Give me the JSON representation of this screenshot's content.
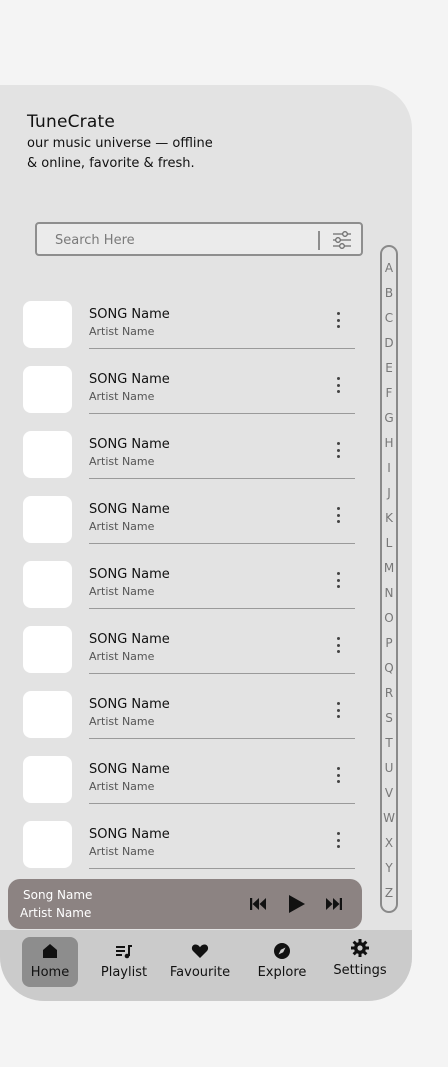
{
  "app": {
    "title": "TuneCrate",
    "tagline": "our music universe — offline & online, favorite & fresh."
  },
  "search": {
    "placeholder": "Search Here",
    "filter_icon": "filter-sliders-icon"
  },
  "songs": [
    {
      "name": "SONG Name",
      "artist": "Artist Name"
    },
    {
      "name": "SONG Name",
      "artist": "Artist Name"
    },
    {
      "name": "SONG Name",
      "artist": "Artist Name"
    },
    {
      "name": "SONG Name",
      "artist": "Artist Name"
    },
    {
      "name": "SONG Name",
      "artist": "Artist Name"
    },
    {
      "name": "SONG Name",
      "artist": "Artist Name"
    },
    {
      "name": "SONG Name",
      "artist": "Artist Name"
    },
    {
      "name": "SONG Name",
      "artist": "Artist Name"
    },
    {
      "name": "SONG Name",
      "artist": "Artist Name"
    }
  ],
  "alphabet": [
    "A",
    "B",
    "C",
    "D",
    "E",
    "F",
    "G",
    "H",
    "I",
    "J",
    "K",
    "L",
    "M",
    "N",
    "O",
    "P",
    "Q",
    "R",
    "S",
    "T",
    "U",
    "V",
    "W",
    "X",
    "Y",
    "Z"
  ],
  "player": {
    "song": "Song Name",
    "artist": "Artist Name",
    "controls": [
      "previous-icon",
      "play-icon",
      "next-icon"
    ]
  },
  "nav": {
    "items": [
      {
        "label": "Home",
        "icon": "home-icon",
        "active": true
      },
      {
        "label": "Playlist",
        "icon": "playlist-icon",
        "active": false
      },
      {
        "label": "Favourite",
        "icon": "heart-icon",
        "active": false
      },
      {
        "label": "Explore",
        "icon": "compass-icon",
        "active": false
      },
      {
        "label": "Settings",
        "icon": "gear-icon",
        "active": false
      }
    ]
  },
  "colors": {
    "background": "#f4f4f4",
    "panel": "#e3e3e3",
    "player": "#8c8382",
    "nav_bar": "#cbcbcb",
    "nav_active": "#8d8d8d"
  }
}
